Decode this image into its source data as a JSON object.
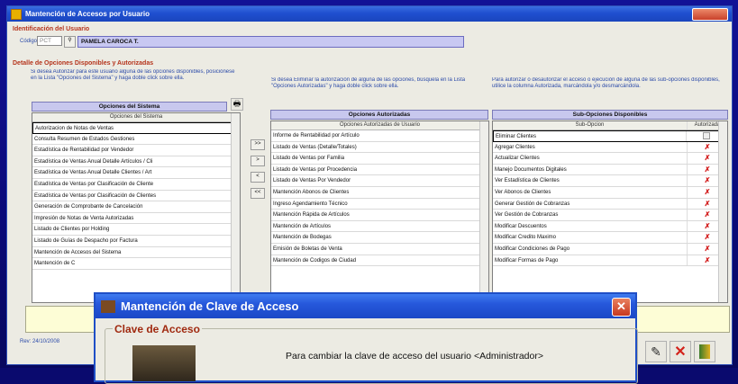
{
  "window": {
    "title": "Mantención de Accesos por Usuario"
  },
  "user_section": {
    "title": "Identificación del Usuario",
    "code_label": "Código",
    "code_value": "PCT",
    "name_value": "PAMELA CAROCA T."
  },
  "detail_section": {
    "title": "Detalle de Opciones Disponibles y Autorizadas",
    "help_left": "Si desea Autorizar para este usuario alguna de las opciones disponibles, posiciónese en la Lista \"Opciones del Sistema\" y haga doble click sobre ella.",
    "help_mid": "Si desea Eliminar la autorización de alguna de las opciones, búsquela en la Lista \"Opciones Autorizadas\" y haga doble click sobre ella.",
    "help_right": "Para autorizar o desautorizar el acceso o ejecución de alguna de las sub-opciones disponibles, utilice la columna Autorizada, marcándola y/o desmarcándola."
  },
  "system_options": {
    "header": "Opciones del Sistema",
    "column": "Opciones del Sistema",
    "items": [
      "Autorizacion de Notas de Ventas",
      "Consulta Resumen de Estados Gestiones",
      "Estadística de Rentabilidad por Vendedor",
      "Estadística de Ventas Anual Detalle Artículos / Cli",
      "Estadística de Ventas Anual Detalle Clientes / Art",
      "Estadística de Ventas por Clasificación de Cliente",
      "Estadística de Ventas por Clasificación de Clientes",
      "Generación de Comprobante de Cancelación",
      "Impresión de Notas de Venta Autorizadas",
      "Listado de Clientes por Holding",
      "Listado de Guías de Despacho por Factura",
      "Mantención de Accesos del Sistema",
      "Mantención de C"
    ]
  },
  "transfer_buttons": [
    ">>",
    ">",
    "<",
    "<<"
  ],
  "authorized_options": {
    "header": "Opciones Autorizadas",
    "column": "Opciones Autorizadas de Usuario",
    "items": [
      "Informe de Rentabilidad por Artículo",
      "Listado de Ventas (Detalle/Totales)",
      "Listado de Ventas por Familia",
      "Listado de Ventas por Procedencia",
      "Listado de Ventas Por Vendedor",
      "Mantención Abonos de Clientes",
      "Ingreso Agendamiento Técnico",
      "Mantención Rápida de Artículos",
      "Mantención de Artículos",
      "Mantención de Bodegas",
      "Emisión de Boletas de Venta",
      "Mantención de Codigos de Ciudad"
    ]
  },
  "sub_options": {
    "header": "Sub-Opciones Disponibles",
    "column": "Sub-Opcion",
    "column2": "Autorizada",
    "items": [
      {
        "label": "Eliminar Clientes",
        "authorized": false
      },
      {
        "label": "Agregar Clientes",
        "authorized": true
      },
      {
        "label": "Actualizar Clientes",
        "authorized": true
      },
      {
        "label": "Manejo Documentos Digitales",
        "authorized": true
      },
      {
        "label": "Ver Estadística de Clientes",
        "authorized": true
      },
      {
        "label": "Ver Abonos de Clientes",
        "authorized": true
      },
      {
        "label": "Generar Gestión de Cobranzas",
        "authorized": true
      },
      {
        "label": "Ver Gestión de Cobranzas",
        "authorized": true
      },
      {
        "label": "Modificar Descuentos",
        "authorized": true
      },
      {
        "label": "Modificar Credito Maximo",
        "authorized": true
      },
      {
        "label": "Modificar Condiciones de Pago",
        "authorized": true
      },
      {
        "label": "Modificar Formas de Pago",
        "authorized": true
      }
    ],
    "check_mark": "✗"
  },
  "footer": {
    "revision": "Rev: 24/10/2008"
  },
  "dialog": {
    "title": "Mantención de Clave de Acceso",
    "close_symbol": "✕",
    "group_label": "Clave de Acceso",
    "message": "Para cambiar la clave de acceso del usuario <Administrador>"
  }
}
